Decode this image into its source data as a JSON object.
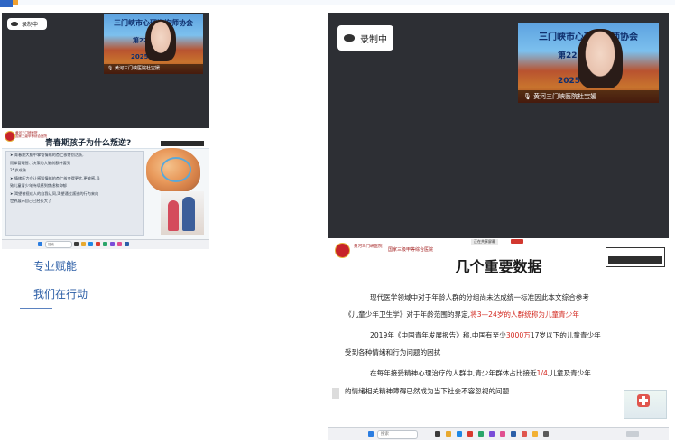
{
  "left_panel": {
    "recording_label": "录制中",
    "video": {
      "banner": "三门峡市心理咨询师协会",
      "number": "第22",
      "year": "2025年",
      "caption": "黄河三门峡医院杜宝媛"
    },
    "slide": {
      "hospital_lines": [
        "黄河三门峡医院",
        "国家三级甲等综合医院"
      ],
      "title": "青春期孩子为什么叛逆?",
      "bullets": [
        "➤ 青春期大脑中掌管情绪的杏仁核特别活跃,",
        "   而掌管理智、决策的大脑前额叶要到",
        "   25岁成熟",
        "➤ 情绪压力会让感知情绪的杏仁核变得更大,更敏感,导",
        "   致儿童青少年持续感到焦虑和抑郁",
        "➤ 渴望被视成人的自我认同,渴望通过叛逆的行为来向",
        "   世界展示自己已经长大了"
      ]
    },
    "taskbar": {
      "search_placeholder": "搜索"
    }
  },
  "links": [
    {
      "label": "专业赋能"
    },
    {
      "label": "我们在行动"
    }
  ],
  "right_panel": {
    "recording_label": "录制中",
    "video": {
      "banner": "三门峡市心理咨询师协会",
      "number": "第223",
      "year": "2025年",
      "caption": "黄河三门峡医院杜宝媛"
    },
    "slide": {
      "topbar": "正在共享屏幕",
      "hospital_1": "黄河三门峡医院",
      "hospital_2": "国家三级甲等综合医院",
      "title": "几个重要数据",
      "p1_line1": "现代医学领域中对于年龄人群的分组尚未达成统一标准因此本文综合参考",
      "p1_line2_a": "《儿童少年卫生学》对于年龄范围的界定,",
      "p1_line2_b": "将3—24岁的人群统称为儿童青少年",
      "p2_line1_a": "2019年《中国青年发展报告》称,中国有至少",
      "p2_line1_b": "3000万",
      "p2_line1_c": "17岁以下的儿童青少年",
      "p2_line2": "受到各种情绪和行为问题的困扰",
      "p3_line1_a": "在每年接受精神心理治疗的人群中,青少年群体占比接近",
      "p3_line1_b": "1/4",
      "p3_line1_c": ",儿童及青少年",
      "p3_line2": "的情绪相关精神障碍已然成为当下社会不容忽视的问题"
    },
    "taskbar": {
      "search_placeholder": "搜索"
    }
  },
  "colors": {
    "link_blue": "#2c5ea6",
    "highlight_red": "#d3281f",
    "screen_dark": "#2d2f34"
  }
}
